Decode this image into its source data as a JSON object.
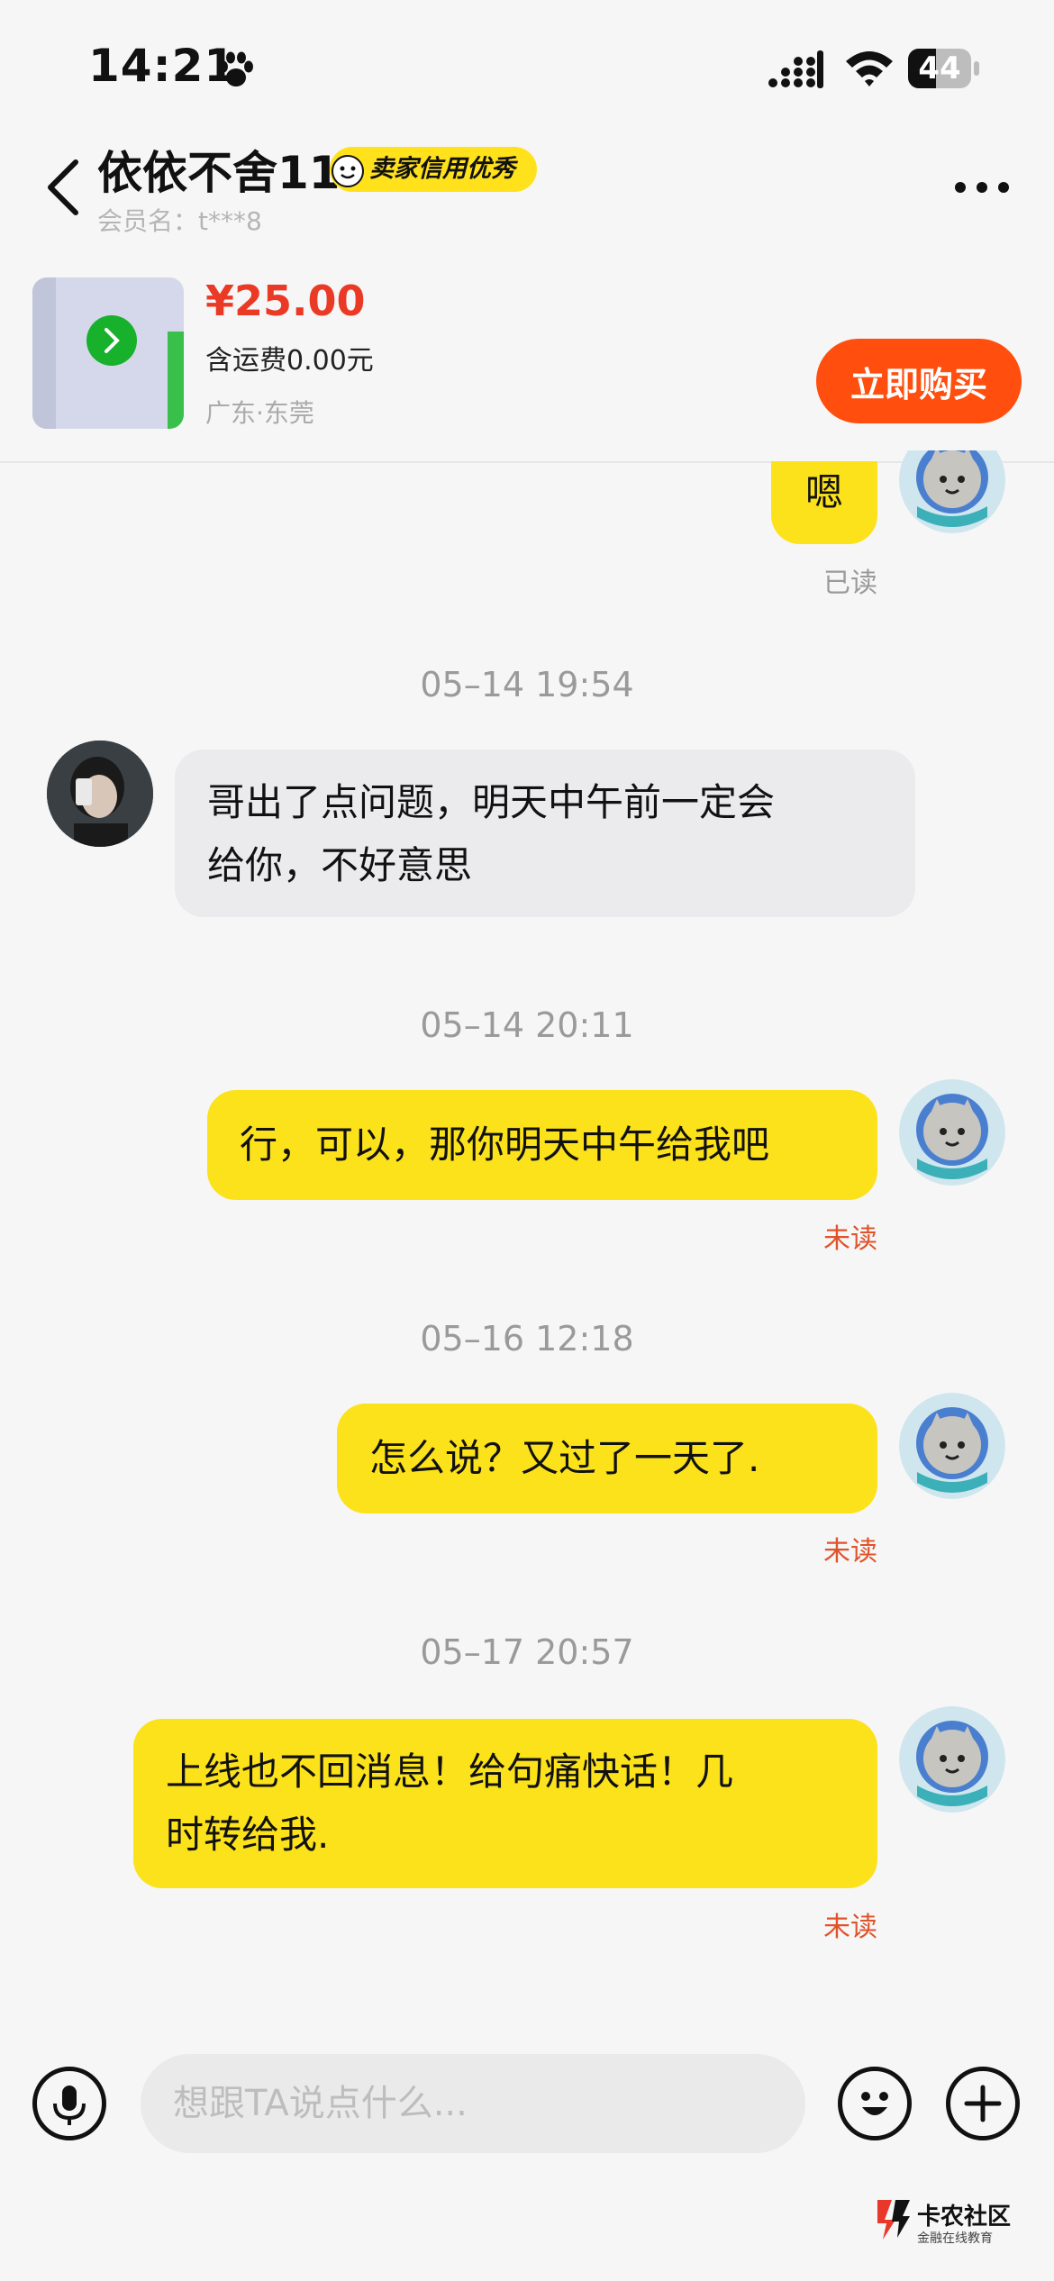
{
  "status_bar": {
    "time": "14:21",
    "battery": "44",
    "battery_level": 0.44
  },
  "header": {
    "title": "依依不舍11",
    "badge": "卖家信用优秀",
    "member": "会员名：t***8"
  },
  "product": {
    "price": "¥25.00",
    "shipping": "含运费0.00元",
    "location": "广东·东莞",
    "buy_label": "立即购买"
  },
  "messages": {
    "m0": {
      "text": "嗯",
      "status": "已读"
    },
    "t1": "05–14 19:54",
    "m1": {
      "line1": "哥出了点问题，明天中午前一定会",
      "line2": "给你，不好意思"
    },
    "t2": "05–14 20:11",
    "m2": {
      "text": "行，可以，那你明天中午给我吧",
      "status": "未读"
    },
    "t3": "05–16 12:18",
    "m3": {
      "text": "怎么说？又过了一天了.",
      "status": "未读"
    },
    "t4": "05–17 20:57",
    "m4": {
      "line1": "上线也不回消息！给句痛快话！几",
      "line2": "时转给我.",
      "status": "未读"
    }
  },
  "input": {
    "placeholder": "想跟TA说点什么..."
  },
  "watermark": {
    "name": "卡农社区",
    "sub": "金融在线教育"
  },
  "colors": {
    "accent_yellow": "#fce21a",
    "buy_orange": "#ff4e0e",
    "price_red": "#ea3a26",
    "unread_red": "#e0532a"
  }
}
